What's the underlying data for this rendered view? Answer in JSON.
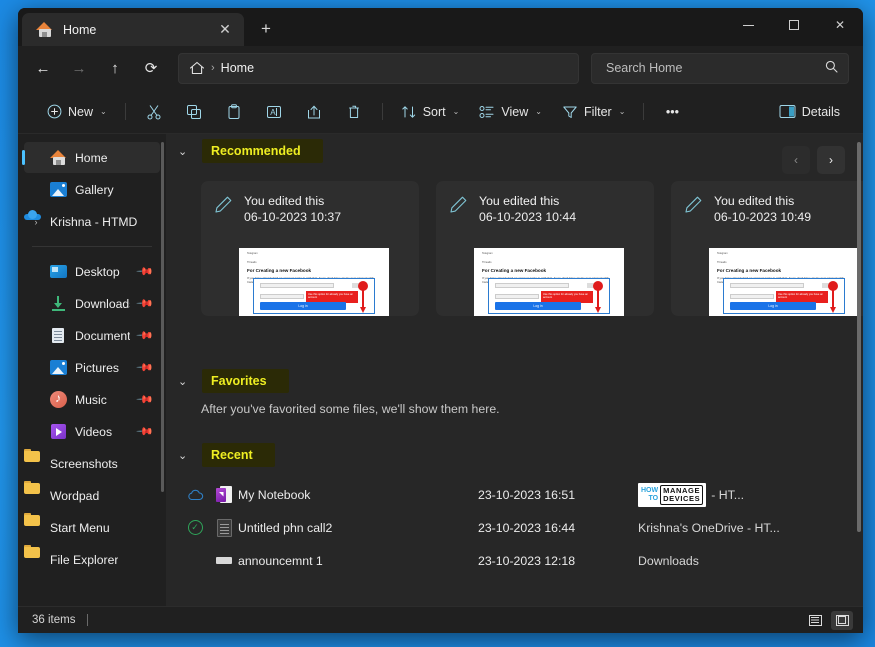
{
  "window": {
    "tab_title": "Home",
    "new_tab_label": "+",
    "close_tab_label": "✕",
    "minimize_label": "–",
    "maximize_label": "□",
    "close_label": "✕"
  },
  "nav": {
    "back": "←",
    "forward": "→",
    "up": "↑",
    "refresh": "⟳",
    "breadcrumb_sep": "›",
    "breadcrumb_text": "Home"
  },
  "search": {
    "placeholder": "Search Home",
    "icon": "search-icon"
  },
  "toolbar": {
    "new_label": "New",
    "sort_label": "Sort",
    "view_label": "View",
    "filter_label": "Filter",
    "more_label": "•••",
    "details_label": "Details",
    "chevron": "⌄",
    "icons": [
      "cut-icon",
      "copy-icon",
      "paste-icon",
      "rename-icon",
      "share-icon",
      "delete-icon"
    ]
  },
  "sidebar": {
    "items": [
      {
        "label": "Home",
        "icon": "home-icon",
        "selected": true,
        "pinned": false,
        "expandable": false
      },
      {
        "label": "Gallery",
        "icon": "gallery-icon",
        "selected": false,
        "pinned": false,
        "expandable": false
      },
      {
        "label": "Krishna - HTMD",
        "icon": "onedrive-cloud-icon",
        "selected": false,
        "pinned": false,
        "expandable": true
      }
    ],
    "quick_access": [
      {
        "label": "Desktop",
        "icon": "desktop-icon",
        "pinned": true
      },
      {
        "label": "Downloads",
        "icon": "downloads-icon",
        "pinned": true
      },
      {
        "label": "Documents",
        "icon": "documents-icon",
        "pinned": true
      },
      {
        "label": "Pictures",
        "icon": "pictures-icon",
        "pinned": true
      },
      {
        "label": "Music",
        "icon": "music-icon",
        "pinned": true
      },
      {
        "label": "Videos",
        "icon": "videos-icon",
        "pinned": true
      },
      {
        "label": "Screenshots",
        "icon": "folder-icon",
        "pinned": false
      },
      {
        "label": "Wordpad",
        "icon": "folder-icon",
        "pinned": false
      },
      {
        "label": "Start Menu",
        "icon": "folder-icon",
        "pinned": false
      },
      {
        "label": "File Explorer",
        "icon": "folder-icon",
        "pinned": false
      }
    ]
  },
  "recommended": {
    "title": "Recommended",
    "chevron": "⌄",
    "prev_label": "‹",
    "next_label": "›",
    "cards": [
      {
        "line1": "You edited this",
        "line2": "06-10-2023 10:37",
        "icon": "pencil-icon",
        "thumb": {
          "meta1": "Telegram",
          "meta2": "Threads",
          "heading": "For Creating a new Facebook",
          "paragraph": "If you have already had an account again to with that, if you don't have create new account with Install ID",
          "callout": "Use this option for already you have an account",
          "button": "Log in"
        }
      },
      {
        "line1": "You edited this",
        "line2": "06-10-2023 10:44",
        "icon": "pencil-icon",
        "thumb": {
          "meta1": "Telegram",
          "meta2": "Threads",
          "heading": "For Creating a new Facebook",
          "paragraph": "If you have already had an account again to with that, if you don't have create new account with Install ID",
          "callout": "Use this option for already you have an account",
          "button": "Log in"
        }
      },
      {
        "line1": "You edited this",
        "line2": "06-10-2023 10:49",
        "icon": "pencil-icon",
        "thumb": {
          "meta1": "Telegram",
          "meta2": "Threads",
          "heading": "For Creating a new Facebook",
          "paragraph": "If you have already had an account again to with that, if you don't have create new account with Install ID",
          "callout": "Use this option for already you have an account",
          "button": "Log in"
        }
      }
    ]
  },
  "favorites": {
    "title": "Favorites",
    "chevron": "⌄",
    "empty_message": "After you've favorited some files, we'll show them here."
  },
  "recent": {
    "title": "Recent",
    "chevron": "⌄",
    "rows": [
      {
        "name": "My Notebook",
        "date": "23-10-2023 16:51",
        "location": "- HT...",
        "status_icon": "cloud-outline-icon",
        "file_icon": "onenote-icon",
        "location_logo": {
          "how": "HOW",
          "to": "TO",
          "manage": "MANAGE",
          "devices": "DEVICES"
        }
      },
      {
        "name": "Untitled phn call2",
        "date": "23-10-2023 16:44",
        "location": "Krishna's OneDrive - HT...",
        "status_icon": "green-check-icon",
        "file_icon": "notes-icon",
        "location_logo": null
      },
      {
        "name": "announcemnt 1",
        "date": "23-10-2023 12:18",
        "location": "Downloads",
        "status_icon": "none",
        "file_icon": "generic-file-icon",
        "location_logo": null
      }
    ]
  },
  "statusbar": {
    "item_count": "36 items",
    "layout_details_label": "details-view-icon",
    "layout_large_label": "large-icons-view-icon"
  },
  "colors": {
    "accent": "#4cc2ff",
    "desktop": "#1c8ae4",
    "window_bg": "#202020",
    "content_bg": "#272727",
    "highlight_text": "#eeee22",
    "highlight_bg": "#2b2a06"
  }
}
